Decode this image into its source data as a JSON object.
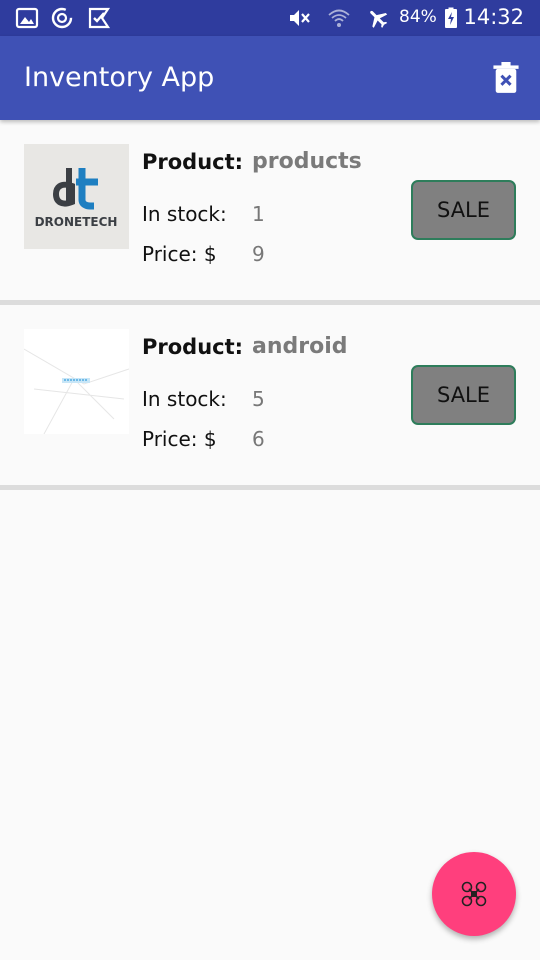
{
  "status_bar": {
    "battery_percent": "84%",
    "time": "14:32",
    "icons": [
      "gallery-icon",
      "sync-icon",
      "check-icon",
      "mute-icon",
      "wifi-icon",
      "airplane-icon",
      "battery-charging-icon"
    ]
  },
  "app_bar": {
    "title": "Inventory App",
    "delete_icon": "delete-icon"
  },
  "products": [
    {
      "product_label": "Product:",
      "name": "products",
      "stock_label": "In stock:",
      "stock": "1",
      "price_label": "Price: $",
      "price": "9",
      "sale_label": "SALE",
      "thumb_text": "DRONETECH"
    },
    {
      "product_label": "Product:",
      "name": "android",
      "stock_label": "In stock:",
      "stock": "5",
      "price_label": "Price: $",
      "price": "6",
      "sale_label": "SALE",
      "thumb_text": ""
    }
  ],
  "fab": {
    "icon": "drone-icon"
  },
  "colors": {
    "status_bar": "#2f3c9e",
    "app_bar": "#3f51b5",
    "fab": "#ff3f7d",
    "sale_button": "#808080",
    "sale_border": "#2e7d5b"
  }
}
